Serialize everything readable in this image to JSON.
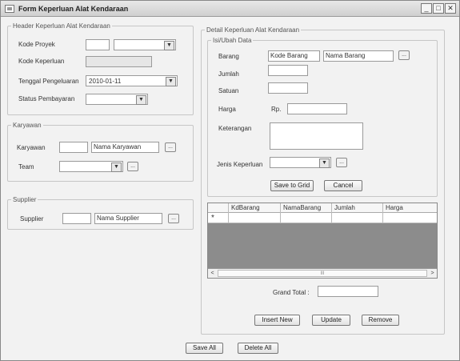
{
  "window": {
    "title": "Form Keperluan Alat Kendaraan",
    "min_glyph": "_",
    "max_glyph": "□",
    "close_glyph": "✕"
  },
  "header_group": {
    "legend": "Header Keperluan Alat Kendaraan",
    "kode_proyek_label": "Kode Proyek",
    "kode_keperluan_label": "Kode Keperluan",
    "tanggal_label": "Tenggal Pengeluaran",
    "tanggal_value": "2010-01-11",
    "status_label": "Status Pembayaran"
  },
  "karyawan_group": {
    "legend": "Karyawan",
    "karyawan_label": "Karyawan",
    "nama_karyawan": "Nama Karyawan",
    "team_label": "Team"
  },
  "supplier_group": {
    "legend": "Supplier",
    "supplier_label": "Supplier",
    "nama_supplier": "Nama Supplier"
  },
  "detail_group": {
    "legend": "Detail Keperluan Alat Kendaraan",
    "isi_legend": "Isi/Ubah Data",
    "barang_label": "Barang",
    "kode_barang": "Kode Barang",
    "nama_barang": "Nama Barang",
    "jumlah_label": "Jumlah",
    "satuan_label": "Satuan",
    "harga_label": "Harga",
    "rp_label": "Rp.",
    "keterangan_label": "Keterangan",
    "jenis_label": "Jenis Keperluan",
    "save_grid": "Save to Grid",
    "cancel": "Cancel"
  },
  "grid": {
    "columns": [
      "KdBarang",
      "NamaBarang",
      "Jumlah",
      "Harga"
    ],
    "new_row_marker": "*",
    "scroll_left": "<",
    "scroll_right": ">",
    "scroll_thumb": "III"
  },
  "footer": {
    "grand_total_label": "Grand Total :",
    "insert_new": "Insert New",
    "update": "Update",
    "remove": "Remove",
    "save_all": "Save All",
    "delete_all": "Delete All"
  },
  "icons": {
    "dropdown": "▼",
    "browse": "..."
  }
}
